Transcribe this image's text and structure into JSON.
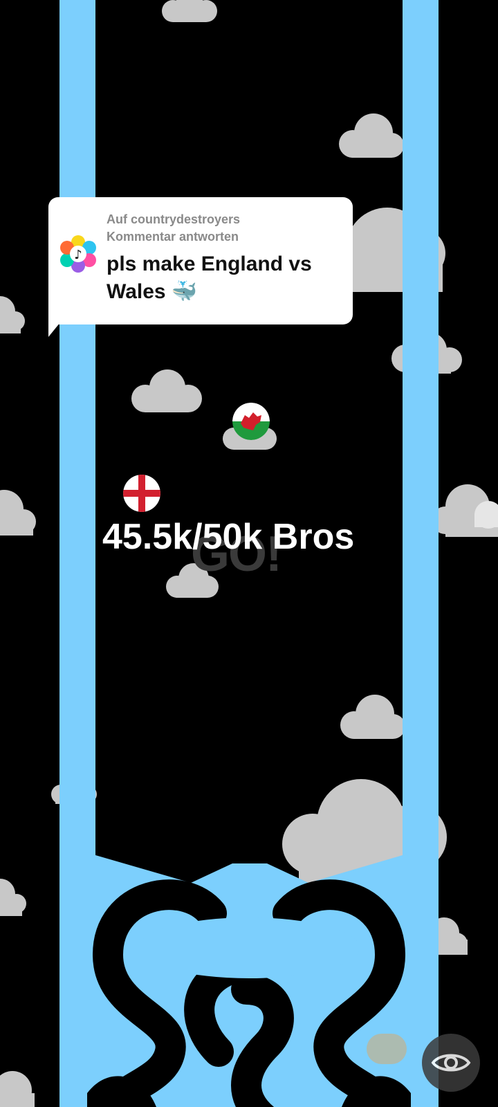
{
  "comment": {
    "reply_prefix": "Auf countrydestroyers",
    "reply_suffix": "Kommentar antworten",
    "text_line1": "pls make England vs",
    "text_line2": "Wales 🐳",
    "logo_icon": "colorful-flower-tiktok-icon"
  },
  "game": {
    "counter": "45.5k/50k Bros",
    "go_label": "GO!",
    "team_a": "England",
    "team_b": "Wales",
    "wall_color": "#7ccffd",
    "background_color": "#000000",
    "cloud_color": "#c8c8c8"
  },
  "controls": {
    "gift_label": "",
    "eye_icon": "eye-icon"
  }
}
